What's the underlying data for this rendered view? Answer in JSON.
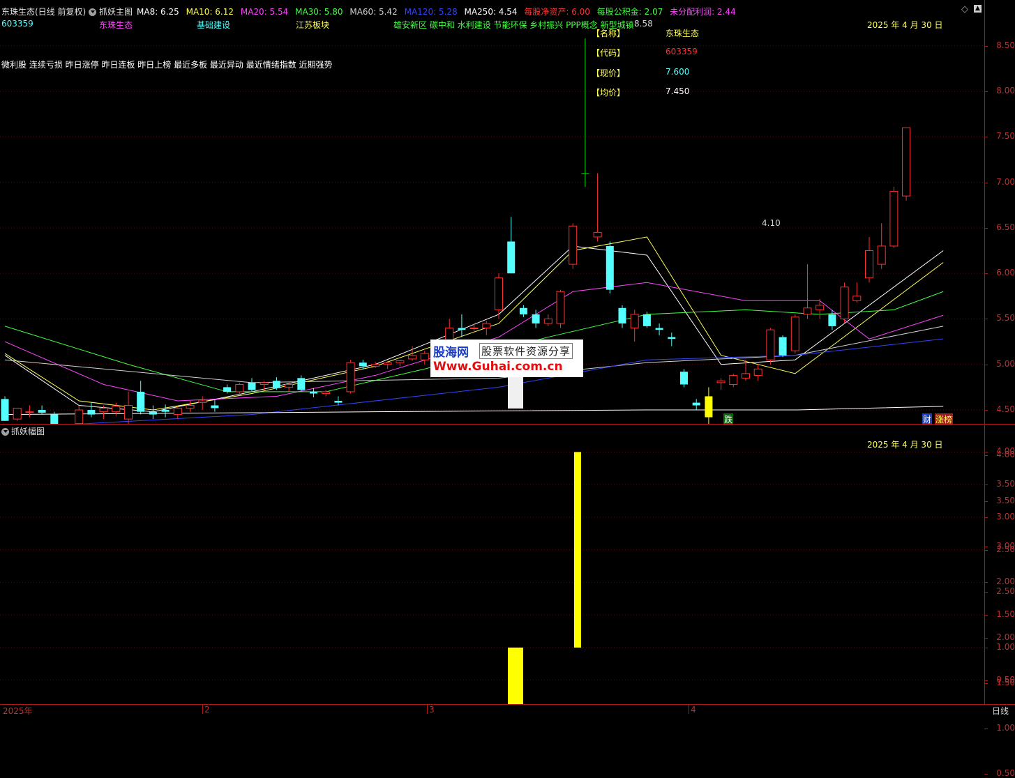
{
  "header": {
    "stock_title": "东珠生态(日线 前复权)",
    "indicator_name": "抓妖主图",
    "ma_items": [
      {
        "label": "MA8: 6.25",
        "color": "#ffffff"
      },
      {
        "label": "MA10: 6.12",
        "color": "#ffff55"
      },
      {
        "label": "MA20: 5.54",
        "color": "#ff44ff"
      },
      {
        "label": "MA30: 5.80",
        "color": "#44ff44"
      },
      {
        "label": "MA60: 5.42",
        "color": "#d0d0d0"
      },
      {
        "label": "MA120: 5.28",
        "color": "#3344ff"
      },
      {
        "label": "MA250: 4.54",
        "color": "#ffffff"
      }
    ],
    "fin_items": [
      {
        "label": "每股净资产: 6.00",
        "color": "#ff3333"
      },
      {
        "label": "每股公积金: 2.07",
        "color": "#44ff44"
      },
      {
        "label": "未分配利润: 2.44",
        "color": "#ff44ff"
      }
    ],
    "icon_diamond": "diamond-icon",
    "icon_up": "up-arrow-icon",
    "icon_down": "down-arrow-icon"
  },
  "row2": {
    "code": "603359",
    "name": "东珠生态",
    "industry": "基础建设",
    "region": "江苏板块",
    "concepts": "雄安新区 碳中和 水利建设 节能环保 乡村振兴 PPP概念 新型城镇"
  },
  "tags_line": "微利股 连续亏损 昨日涨停 昨日连板 昨日上榜 最近多板 最近异动 最近情绪指数 近期强势",
  "info_box": {
    "name_key": "【名称】",
    "name_val": "东珠生态",
    "code_key": "【代码】",
    "code_val": "603359",
    "price_key": "【现价】",
    "price_val": "7.600",
    "avg_key": "【均价】",
    "avg_val": "7.450"
  },
  "main_date": "2025 年 4 月 30 日",
  "sub_date": "2025 年 4 月 30 日",
  "high_label": "8.58",
  "low_label": "4.10",
  "markers": {
    "die": "跌",
    "cai": "财",
    "zhangbang": "涨榜"
  },
  "sub_title": "抓妖幅图",
  "watermark": {
    "site": "股海网",
    "tag": "股票软件资源分享",
    "url": "Www.Guhai.com.cn"
  },
  "y_axis_main": [
    "8.50",
    "8.00",
    "7.50",
    "7.00",
    "6.50",
    "6.00",
    "5.50",
    "5.00",
    "4.50",
    "4.00",
    "3.50",
    "3.00",
    "2.50",
    "2.00",
    "1.50",
    "1.00",
    "0.50"
  ],
  "y_axis_sub": [
    "4.00",
    "3.50",
    "3.00",
    "2.50",
    "2.00",
    "1.50",
    "1.00",
    "0.50"
  ],
  "x_axis": [
    "2025年",
    "2",
    "3",
    "4"
  ],
  "period_label": "日线",
  "colors": {
    "up": "#ff3030",
    "down": "#54ffff",
    "limit_up_bar": "#00ee00",
    "yellow": "#ffff00",
    "axis": "#c03030"
  },
  "chart_data": {
    "type": "candlestick",
    "price_range": [
      0.25,
      8.75
    ],
    "candles": [
      {
        "o": 4.62,
        "h": 4.65,
        "l": 4.38,
        "c": 4.38
      },
      {
        "o": 4.4,
        "h": 4.52,
        "l": 4.38,
        "c": 4.52
      },
      {
        "o": 4.48,
        "h": 4.55,
        "l": 4.42,
        "c": 4.48
      },
      {
        "o": 4.5,
        "h": 4.55,
        "l": 4.45,
        "c": 4.47
      },
      {
        "o": 4.45,
        "h": 4.48,
        "l": 4.28,
        "c": 4.3
      },
      {
        "o": 4.28,
        "h": 4.32,
        "l": 4.18,
        "c": 4.24
      },
      {
        "o": 4.35,
        "h": 4.55,
        "l": 4.3,
        "c": 4.5
      },
      {
        "o": 4.5,
        "h": 4.58,
        "l": 4.42,
        "c": 4.45
      },
      {
        "o": 4.48,
        "h": 4.55,
        "l": 4.4,
        "c": 4.52
      },
      {
        "o": 4.48,
        "h": 4.58,
        "l": 4.44,
        "c": 4.54
      },
      {
        "o": 4.4,
        "h": 4.7,
        "l": 4.28,
        "c": 4.55
      },
      {
        "o": 4.7,
        "h": 4.82,
        "l": 4.45,
        "c": 4.48
      },
      {
        "o": 4.48,
        "h": 4.55,
        "l": 4.4,
        "c": 4.45
      },
      {
        "o": 4.5,
        "h": 4.56,
        "l": 4.42,
        "c": 4.48
      },
      {
        "o": 4.45,
        "h": 4.54,
        "l": 4.4,
        "c": 4.52
      },
      {
        "o": 4.52,
        "h": 4.6,
        "l": 4.48,
        "c": 4.55
      },
      {
        "o": 4.58,
        "h": 4.65,
        "l": 4.5,
        "c": 4.6
      },
      {
        "o": 4.55,
        "h": 4.62,
        "l": 4.48,
        "c": 4.52
      },
      {
        "o": 4.75,
        "h": 4.78,
        "l": 4.68,
        "c": 4.7
      },
      {
        "o": 4.7,
        "h": 4.8,
        "l": 4.66,
        "c": 4.78
      },
      {
        "o": 4.8,
        "h": 4.85,
        "l": 4.7,
        "c": 4.72
      },
      {
        "o": 4.78,
        "h": 4.82,
        "l": 4.72,
        "c": 4.8
      },
      {
        "o": 4.82,
        "h": 4.86,
        "l": 4.72,
        "c": 4.74
      },
      {
        "o": 4.75,
        "h": 4.8,
        "l": 4.7,
        "c": 4.78
      },
      {
        "o": 4.85,
        "h": 4.88,
        "l": 4.7,
        "c": 4.72
      },
      {
        "o": 4.7,
        "h": 4.74,
        "l": 4.64,
        "c": 4.68
      },
      {
        "o": 4.68,
        "h": 4.72,
        "l": 4.65,
        "c": 4.7
      },
      {
        "o": 4.6,
        "h": 4.65,
        "l": 4.55,
        "c": 4.58
      },
      {
        "o": 4.7,
        "h": 5.05,
        "l": 4.68,
        "c": 5.02
      },
      {
        "o": 5.02,
        "h": 5.05,
        "l": 4.95,
        "c": 4.98
      },
      {
        "o": 4.98,
        "h": 5.03,
        "l": 4.96,
        "c": 5.0
      },
      {
        "o": 5.0,
        "h": 5.04,
        "l": 4.95,
        "c": 5.02
      },
      {
        "o": 5.02,
        "h": 5.05,
        "l": 4.98,
        "c": 5.04
      },
      {
        "o": 5.06,
        "h": 5.2,
        "l": 5.04,
        "c": 5.1
      },
      {
        "o": 5.05,
        "h": 5.15,
        "l": 5.0,
        "c": 5.12
      },
      {
        "o": 5.1,
        "h": 5.12,
        "l": 5.06,
        "c": 5.08
      },
      {
        "o": 5.05,
        "h": 5.5,
        "l": 5.02,
        "c": 5.4
      },
      {
        "o": 5.4,
        "h": 5.55,
        "l": 5.3,
        "c": 5.38
      },
      {
        "o": 5.4,
        "h": 5.45,
        "l": 5.35,
        "c": 5.4
      },
      {
        "o": 5.4,
        "h": 5.48,
        "l": 5.32,
        "c": 5.45
      },
      {
        "o": 5.6,
        "h": 6.0,
        "l": 5.5,
        "c": 5.95
      },
      {
        "o": 6.35,
        "h": 6.62,
        "l": 6.0,
        "c": 6.0
      },
      {
        "o": 5.62,
        "h": 5.65,
        "l": 5.52,
        "c": 5.55
      },
      {
        "o": 5.55,
        "h": 5.6,
        "l": 5.4,
        "c": 5.45
      },
      {
        "o": 5.45,
        "h": 5.55,
        "l": 5.42,
        "c": 5.5
      },
      {
        "o": 5.45,
        "h": 5.82,
        "l": 5.4,
        "c": 5.8
      },
      {
        "o": 6.1,
        "h": 6.55,
        "l": 6.05,
        "c": 6.52
      },
      {
        "o": 7.1,
        "h": 8.58,
        "l": 6.95,
        "c": 7.1
      },
      {
        "o": 6.4,
        "h": 7.1,
        "l": 6.35,
        "c": 6.45
      },
      {
        "o": 6.3,
        "h": 6.35,
        "l": 5.78,
        "c": 5.82
      },
      {
        "o": 5.62,
        "h": 5.65,
        "l": 5.4,
        "c": 5.45
      },
      {
        "o": 5.4,
        "h": 5.6,
        "l": 5.25,
        "c": 5.55
      },
      {
        "o": 5.55,
        "h": 5.58,
        "l": 5.4,
        "c": 5.42
      },
      {
        "o": 5.4,
        "h": 5.45,
        "l": 5.32,
        "c": 5.38
      },
      {
        "o": 5.3,
        "h": 5.35,
        "l": 5.2,
        "c": 5.28
      },
      {
        "o": 4.92,
        "h": 4.95,
        "l": 4.75,
        "c": 4.78
      },
      {
        "o": 4.58,
        "h": 4.62,
        "l": 4.5,
        "c": 4.55
      },
      {
        "o": 4.65,
        "h": 4.75,
        "l": 4.1,
        "c": 4.42
      },
      {
        "o": 4.8,
        "h": 4.85,
        "l": 4.72,
        "c": 4.82
      },
      {
        "o": 4.78,
        "h": 4.9,
        "l": 4.75,
        "c": 4.88
      },
      {
        "o": 4.85,
        "h": 5.05,
        "l": 4.82,
        "c": 4.9
      },
      {
        "o": 4.88,
        "h": 5.0,
        "l": 4.82,
        "c": 4.95
      },
      {
        "o": 5.05,
        "h": 5.4,
        "l": 5.0,
        "c": 5.38
      },
      {
        "o": 5.3,
        "h": 5.32,
        "l": 5.08,
        "c": 5.1
      },
      {
        "o": 5.15,
        "h": 5.55,
        "l": 5.12,
        "c": 5.52
      },
      {
        "o": 5.55,
        "h": 6.1,
        "l": 5.5,
        "c": 5.62
      },
      {
        "o": 5.6,
        "h": 5.72,
        "l": 5.5,
        "c": 5.65
      },
      {
        "o": 5.55,
        "h": 5.6,
        "l": 5.38,
        "c": 5.42
      },
      {
        "o": 5.5,
        "h": 5.9,
        "l": 5.45,
        "c": 5.85
      },
      {
        "o": 5.7,
        "h": 5.9,
        "l": 5.68,
        "c": 5.75
      },
      {
        "o": 5.95,
        "h": 6.4,
        "l": 5.9,
        "c": 6.25
      },
      {
        "o": 6.1,
        "h": 6.55,
        "l": 6.05,
        "c": 6.3
      },
      {
        "o": 6.3,
        "h": 6.95,
        "l": 6.28,
        "c": 6.9
      },
      {
        "o": 6.85,
        "h": 7.6,
        "l": 6.8,
        "c": 7.6
      }
    ],
    "special_bars": [
      {
        "index": 47,
        "color": "#00ee00"
      },
      {
        "index": 57,
        "color": "#ffff00"
      }
    ],
    "ma_lines": [
      {
        "name": "MA8",
        "color": "#ffffff",
        "points": [
          [
            0,
            5.1
          ],
          [
            6,
            4.55
          ],
          [
            12,
            4.48
          ],
          [
            20,
            4.7
          ],
          [
            30,
            5.0
          ],
          [
            40,
            5.55
          ],
          [
            46,
            6.3
          ],
          [
            52,
            6.2
          ],
          [
            58,
            5.0
          ],
          [
            64,
            5.05
          ],
          [
            76,
            6.25
          ]
        ]
      },
      {
        "name": "MA10",
        "color": "#ffff55",
        "points": [
          [
            0,
            5.12
          ],
          [
            6,
            4.6
          ],
          [
            12,
            4.5
          ],
          [
            20,
            4.68
          ],
          [
            30,
            4.98
          ],
          [
            40,
            5.45
          ],
          [
            46,
            6.25
          ],
          [
            52,
            6.4
          ],
          [
            58,
            5.1
          ],
          [
            64,
            4.9
          ],
          [
            76,
            6.12
          ]
        ]
      },
      {
        "name": "MA20",
        "color": "#ff44ff",
        "points": [
          [
            0,
            5.25
          ],
          [
            8,
            4.78
          ],
          [
            14,
            4.6
          ],
          [
            22,
            4.65
          ],
          [
            30,
            4.88
          ],
          [
            40,
            5.3
          ],
          [
            46,
            5.8
          ],
          [
            52,
            5.9
          ],
          [
            60,
            5.7
          ],
          [
            66,
            5.7
          ],
          [
            70,
            5.28
          ],
          [
            76,
            5.54
          ]
        ]
      },
      {
        "name": "MA30",
        "color": "#44ff44",
        "points": [
          [
            0,
            5.42
          ],
          [
            10,
            5.0
          ],
          [
            18,
            4.7
          ],
          [
            26,
            4.7
          ],
          [
            34,
            4.95
          ],
          [
            44,
            5.3
          ],
          [
            52,
            5.55
          ],
          [
            60,
            5.6
          ],
          [
            66,
            5.55
          ],
          [
            72,
            5.6
          ],
          [
            76,
            5.8
          ]
        ]
      },
      {
        "name": "MA60",
        "color": "#d0d0d0",
        "points": [
          [
            0,
            5.05
          ],
          [
            20,
            4.8
          ],
          [
            40,
            4.85
          ],
          [
            52,
            5.02
          ],
          [
            64,
            5.1
          ],
          [
            76,
            5.42
          ]
        ]
      },
      {
        "name": "MA120",
        "color": "#3344ff",
        "points": [
          [
            0,
            4.3
          ],
          [
            20,
            4.45
          ],
          [
            40,
            4.75
          ],
          [
            52,
            5.05
          ],
          [
            64,
            5.1
          ],
          [
            76,
            5.28
          ]
        ]
      },
      {
        "name": "MA250",
        "color": "#ffffff",
        "points": [
          [
            0,
            4.45
          ],
          [
            30,
            4.48
          ],
          [
            52,
            4.5
          ],
          [
            64,
            4.5
          ],
          [
            76,
            4.54
          ]
        ]
      }
    ],
    "sub_series": {
      "range": [
        0,
        4.25
      ],
      "bars": [
        {
          "index": 41,
          "from": 0,
          "to": 1.0,
          "color": "#ffff00"
        },
        {
          "index": 46,
          "from": 1.0,
          "to": 4.0,
          "color": "#ffff00"
        }
      ]
    }
  }
}
